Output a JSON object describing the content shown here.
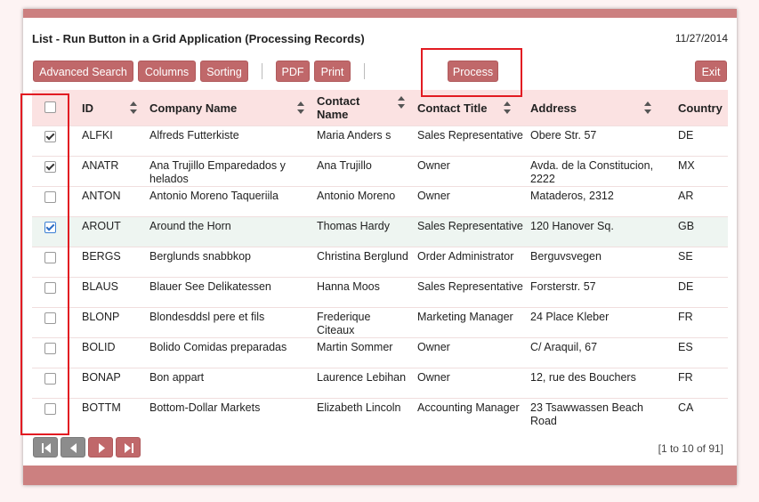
{
  "header": {
    "title": "List - Run Button in a Grid Application (Processing Records)",
    "date": "11/27/2014"
  },
  "toolbar": {
    "advanced_search": "Advanced Search",
    "columns": "Columns",
    "sorting": "Sorting",
    "pdf": "PDF",
    "print": "Print",
    "process": "Process",
    "exit": "Exit"
  },
  "grid": {
    "columns": [
      "ID",
      "Company Name",
      "Contact Name",
      "Contact Title",
      "Address",
      "Country"
    ],
    "rows": [
      {
        "checked": true,
        "id": "ALFKI",
        "company": "Alfreds Futterkiste",
        "contact": "Maria Anders s",
        "title": "Sales Representative",
        "address": "Obere Str. 57",
        "country": "DE"
      },
      {
        "checked": true,
        "id": "ANATR",
        "company": "Ana Trujillo Emparedados y helados",
        "contact": "Ana Trujillo",
        "title": "Owner",
        "address": "Avda. de la Constitucion, 2222",
        "country": "MX"
      },
      {
        "checked": false,
        "id": "ANTON",
        "company": "Antonio Moreno Taqueriila",
        "contact": "Antonio Moreno",
        "title": "Owner",
        "address": "Mataderos, 2312",
        "country": "AR"
      },
      {
        "checked": true,
        "id": "AROUT",
        "company": "Around the Horn",
        "contact": "Thomas Hardy",
        "title": "Sales Representative",
        "address": "120 Hanover Sq.",
        "country": "GB"
      },
      {
        "checked": false,
        "id": "BERGS",
        "company": "Berglunds snabbkop",
        "contact": "Christina Berglund",
        "title": "Order Administrator",
        "address": "Berguvsvegen",
        "country": "SE"
      },
      {
        "checked": false,
        "id": "BLAUS",
        "company": "Blauer See Delikatessen",
        "contact": "Hanna Moos",
        "title": "Sales Representative",
        "address": "Forsterstr. 57",
        "country": "DE"
      },
      {
        "checked": false,
        "id": "BLONP",
        "company": "Blondesddsl pere et fils",
        "contact": "Frederique Citeaux",
        "title": "Marketing Manager",
        "address": "24 Place Kleber",
        "country": "FR"
      },
      {
        "checked": false,
        "id": "BOLID",
        "company": "Bolido Comidas preparadas",
        "contact": "Martin Sommer",
        "title": "Owner",
        "address": "C/ Araquil, 67",
        "country": "ES"
      },
      {
        "checked": false,
        "id": "BONAP",
        "company": "Bon appart",
        "contact": "Laurence Lebihan",
        "title": "Owner",
        "address": "12, rue des Bouchers",
        "country": "FR"
      },
      {
        "checked": false,
        "id": "BOTTM",
        "company": "Bottom-Dollar Markets",
        "contact": "Elizabeth Lincoln",
        "title": "Accounting Manager",
        "address": "23 Tsawwassen Beach Road",
        "country": "CA"
      }
    ]
  },
  "pager": {
    "record_count": "[1 to 10 of 91]"
  },
  "icons": {
    "first": "first-page-icon",
    "prev": "previous-page-icon",
    "next": "next-page-icon",
    "last": "last-page-icon"
  },
  "colors": {
    "accent": "#c0686a",
    "bar": "#cc8080",
    "header_bg": "#fbe2e2",
    "highlight": "#e21b22"
  }
}
